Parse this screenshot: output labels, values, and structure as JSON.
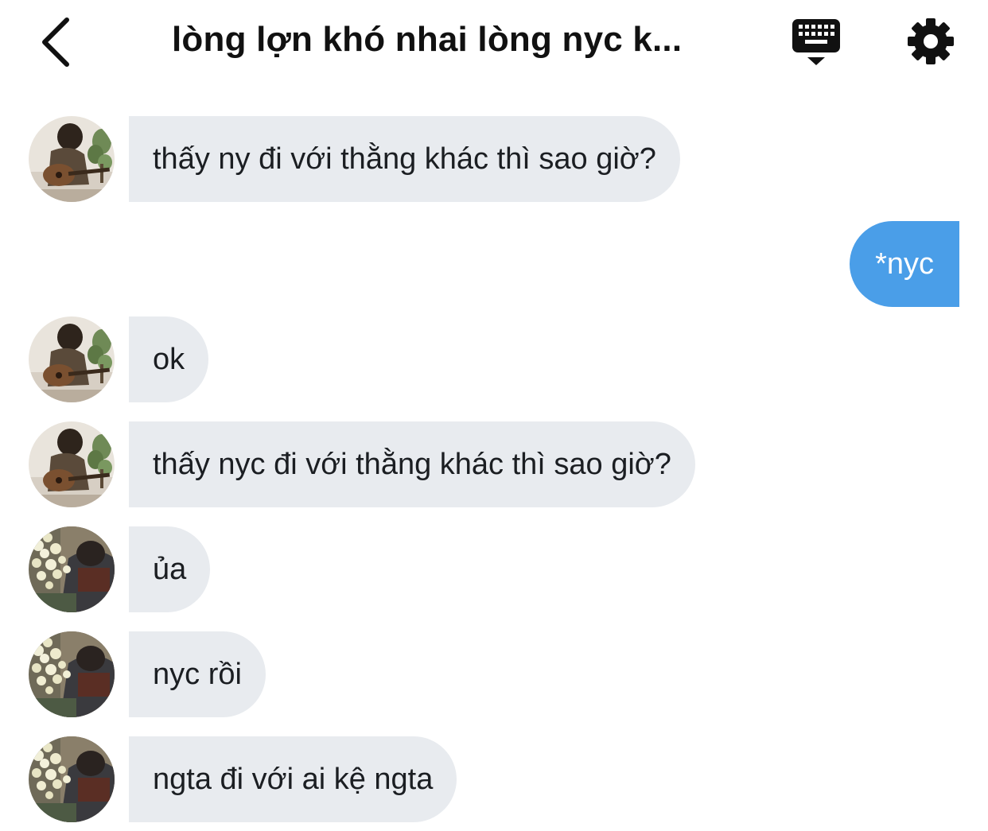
{
  "header": {
    "back_icon": "chevron-left-icon",
    "title": "lòng lợn khó nhai lòng nyc k...",
    "keyboard_icon": "keyboard-hide-icon",
    "settings_icon": "gear-icon"
  },
  "colors": {
    "incoming_bubble": "#e8ebef",
    "outgoing_bubble": "#4a9ee8",
    "outgoing_text": "#ffffff",
    "text": "#1b1e22"
  },
  "messages": [
    {
      "side": "in",
      "avatar": "avatar-guitar",
      "text": "thấy ny đi với thằng khác thì sao giờ?"
    },
    {
      "side": "out",
      "text": "*nyc"
    },
    {
      "side": "in",
      "avatar": "avatar-guitar",
      "text": "ok"
    },
    {
      "side": "in",
      "avatar": "avatar-guitar",
      "text": "thấy nyc đi với thằng khác thì sao giờ?"
    },
    {
      "side": "in",
      "avatar": "avatar-flowers",
      "text": "ủa"
    },
    {
      "side": "in",
      "avatar": "avatar-flowers",
      "text": "nyc rồi"
    },
    {
      "side": "in",
      "avatar": "avatar-flowers",
      "text": "ngta đi với ai kệ ngta"
    }
  ]
}
